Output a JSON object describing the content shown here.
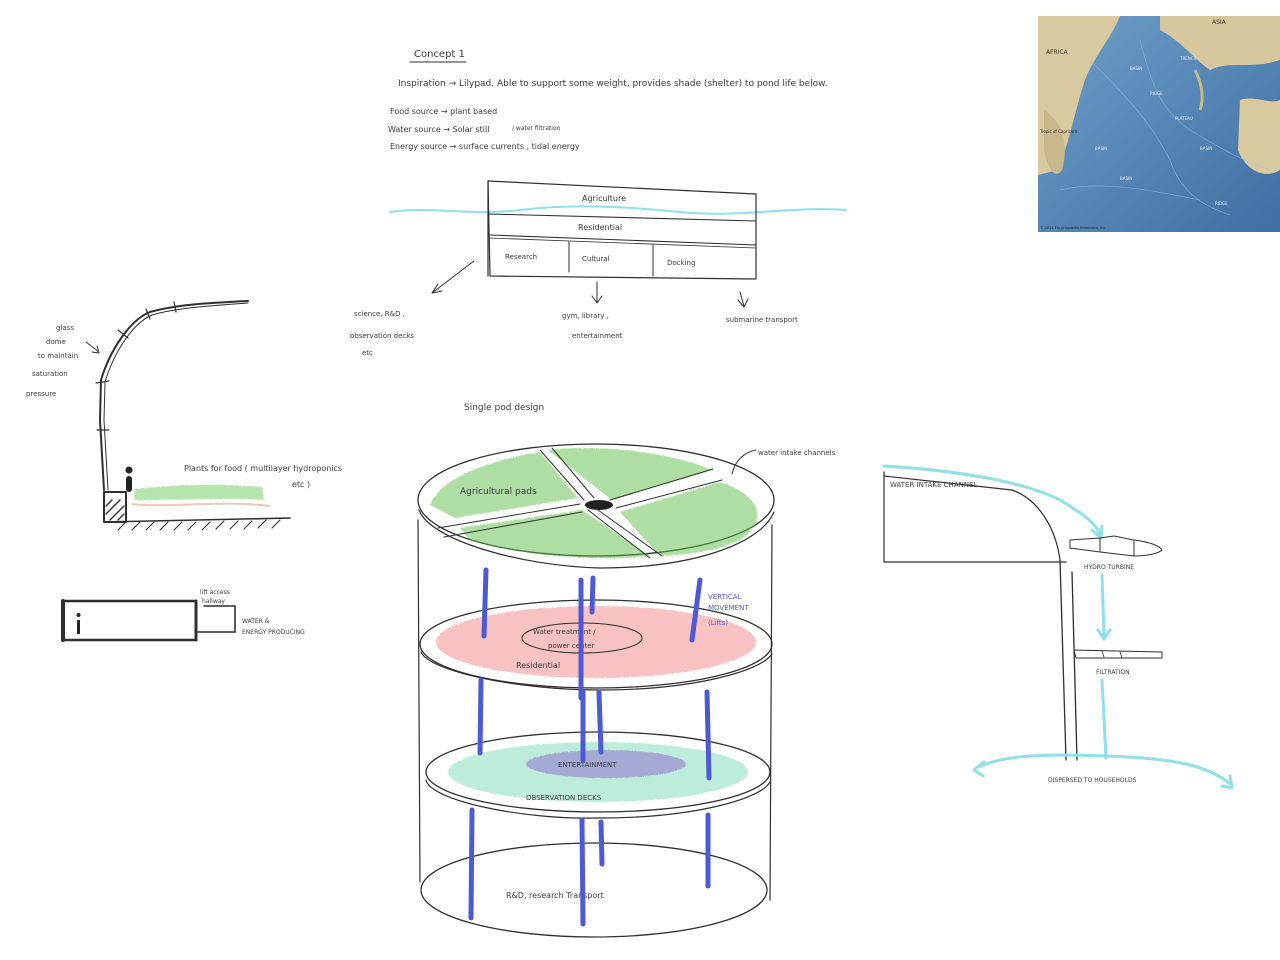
{
  "concept": {
    "title": "Concept 1",
    "inspiration": "Inspiration → Lilypad. Able to support some weight, provides shade (shelter) to pond life below.",
    "food": "Food source → plant based",
    "water": "Water source → Solar still",
    "water_alt": "/ water filtration",
    "energy": "Energy source → surface currents , tidal energy"
  },
  "section": {
    "agriculture": "Agriculture",
    "residential": "Residential",
    "research": "Research",
    "cultural": "Cultural",
    "docking": "Docking",
    "research_note_1": "science, R&D ,",
    "research_note_2": "observation decks",
    "research_note_3": "etc",
    "cultural_note_1": "gym, library ,",
    "cultural_note_2": "entertainment",
    "docking_note": "submarine transport"
  },
  "dome": {
    "label_1": "glass",
    "label_2": "dome",
    "label_3": "to maintain",
    "label_4": "saturation",
    "label_5": "pressure",
    "plants_1": "Plants for food ( multilayer hydroponics",
    "plants_2": "etc )"
  },
  "hallway": {
    "label_1": "lift access",
    "label_2": "hallway",
    "label_3": "WATER &",
    "label_4": "ENERGY PRODUCING"
  },
  "pod": {
    "title": "Single pod design",
    "channels": "water intake channels",
    "agri_pads": "Agricultural pads",
    "water_treat_1": "Water treatment /",
    "water_treat_2": "power center",
    "residential": "Residential",
    "vertical_1": "VERTICAL",
    "vertical_2": "MOVEMENT",
    "vertical_3": "(Lifts)",
    "entertainment": "ENTERTAINMENT",
    "observation": "OBSERVATION DECKS",
    "bottom": "R&D, research   Transport"
  },
  "water_flow": {
    "intake": "WATER INTAKE CHANNEL",
    "turbine": "HYDRO TURBINE",
    "filtration": "FILTRATION",
    "dispersed": "DISPERSED TO HOUSEHOLDS"
  },
  "map": {
    "africa": "AFRICA",
    "asia": "ASIA",
    "capricorn": "Tropic of Capricorn",
    "footer": "© 2014 Encyclopædia Britannica, Inc."
  },
  "colors": {
    "ink": "#2f2f2f",
    "water_line": "#8fe0ea",
    "lift_blue": "#4d59d6",
    "agri_green": "#5fbf4a",
    "res_red": "#f07a7a",
    "obs_teal": "#6fd6b0",
    "ent_purple": "#9a8fd0"
  }
}
